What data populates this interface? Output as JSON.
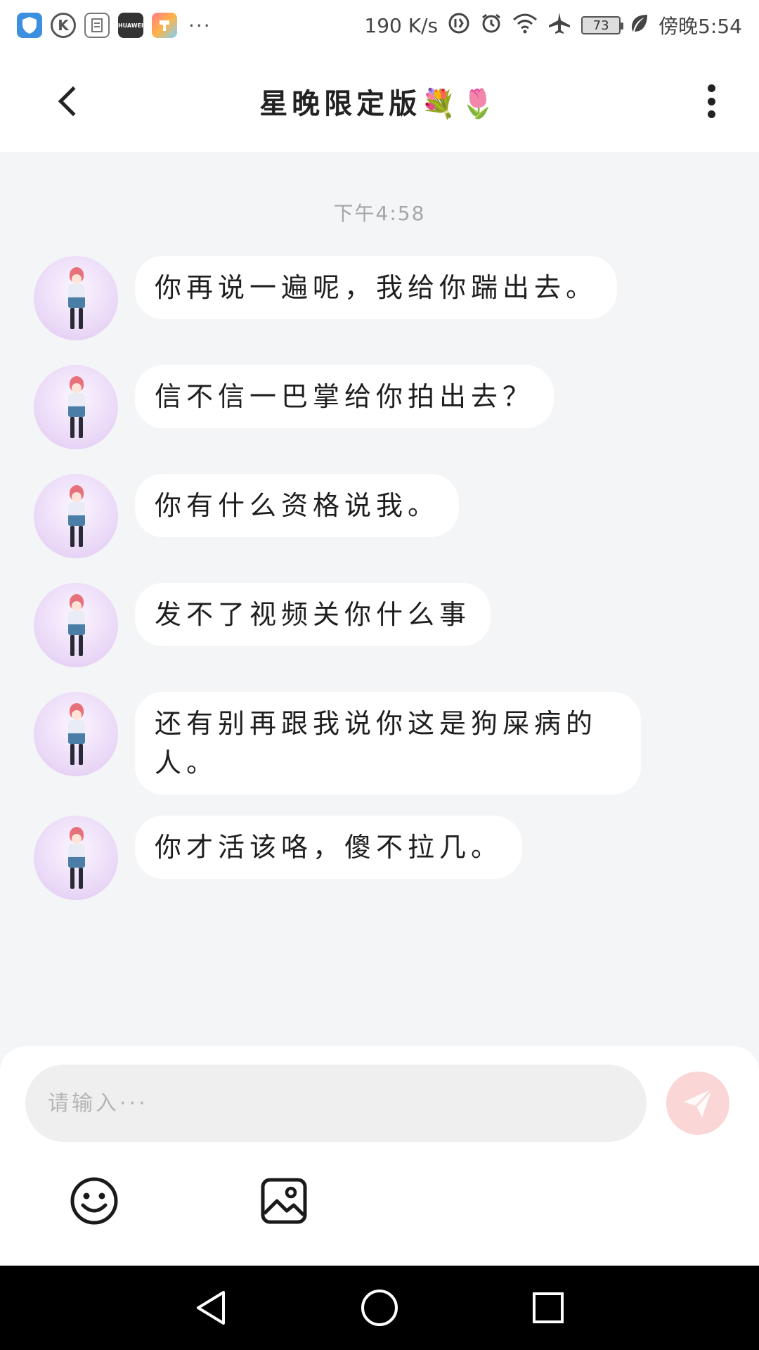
{
  "status_bar": {
    "app_icons": [
      "shield-app-icon",
      "k-app-icon",
      "document-app-icon",
      "huawei-app-icon",
      "theme-app-icon"
    ],
    "huawei_label": "HUAWEI",
    "overflow": "···",
    "network_speed": "190 K/s",
    "battery_level": "73",
    "time": "傍晚5:54"
  },
  "header": {
    "title": "星晚限定版💐🌷"
  },
  "chat": {
    "timestamp": "下午4:58",
    "messages": [
      {
        "text": "你再说一遍呢，我给你踹出去。"
      },
      {
        "text": "信不信一巴掌给你拍出去？"
      },
      {
        "text": "你有什么资格说我。"
      },
      {
        "text": "发不了视频关你什么事"
      },
      {
        "text": "还有别再跟我说你这是狗屎病的人。"
      },
      {
        "text": "你才活该咯，傻不拉几。"
      }
    ]
  },
  "composer": {
    "placeholder": "请输入···",
    "send_color": "#fbd6d6"
  },
  "colors": {
    "background": "#f4f5f7",
    "bubble": "#ffffff",
    "nav_bar": "#000000"
  }
}
